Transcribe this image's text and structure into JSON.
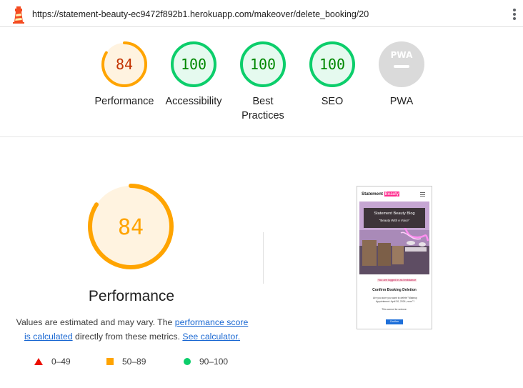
{
  "topbar": {
    "url": "https://statement-beauty-ec9472f892b1.herokuapp.com/makeover/delete_booking/20",
    "logo_icon": "lighthouse-icon",
    "menu_icon": "kebab-menu-icon"
  },
  "gauges": [
    {
      "id": "performance",
      "score": "84",
      "score_value": 84,
      "label": "Performance",
      "status": "average",
      "color": "#ffa400",
      "text_color": "#c33300",
      "fill": "#fff3e0"
    },
    {
      "id": "accessibility",
      "score": "100",
      "score_value": 100,
      "label": "Accessibility",
      "status": "pass",
      "color": "#0cce6b",
      "text_color": "#008800",
      "fill": "#e5faef"
    },
    {
      "id": "best-practices",
      "score": "100",
      "score_value": 100,
      "label": "Best Practices",
      "label_lines": [
        "Best",
        "Practices"
      ],
      "status": "pass",
      "color": "#0cce6b",
      "text_color": "#008800",
      "fill": "#e5faef"
    },
    {
      "id": "seo",
      "score": "100",
      "score_value": 100,
      "label": "SEO",
      "status": "pass",
      "color": "#0cce6b",
      "text_color": "#008800",
      "fill": "#e5faef"
    },
    {
      "id": "pwa",
      "score": "PWA",
      "label": "PWA",
      "status": "na",
      "color": "#dadada",
      "text_color": "#ffffff"
    }
  ],
  "performance": {
    "score": "84",
    "score_value": 84,
    "title": "Performance",
    "desc_1": "Values are estimated and may vary. The ",
    "link_1a": "performance score",
    "link_1b": "is calculated",
    "desc_2": " directly from these metrics. ",
    "link_2": "See calculator.",
    "color": "#ffa400",
    "text_color": "#ffa400"
  },
  "legend": [
    {
      "shape": "triangle",
      "range": "0–49",
      "color": "#eb0f00"
    },
    {
      "shape": "square",
      "range": "50–89",
      "color": "#ffa400"
    },
    {
      "shape": "circle",
      "range": "90–100",
      "color": "#0cce6b"
    }
  ],
  "thumbnail": {
    "brand_1": "Statement",
    "brand_2": "Beauty",
    "banner_title": "Statement Beauty Blog",
    "banner_sub": "\"Beauty With A Voice\"",
    "flash": "You are logged in as bmbdance",
    "heading": "Confirm Booking Deletion",
    "body": "Are you sure you want to delete \"Makeup Appointment: April 30, 2024, noon\"?",
    "note": "This cannot be undone.",
    "button": "Confirm"
  }
}
